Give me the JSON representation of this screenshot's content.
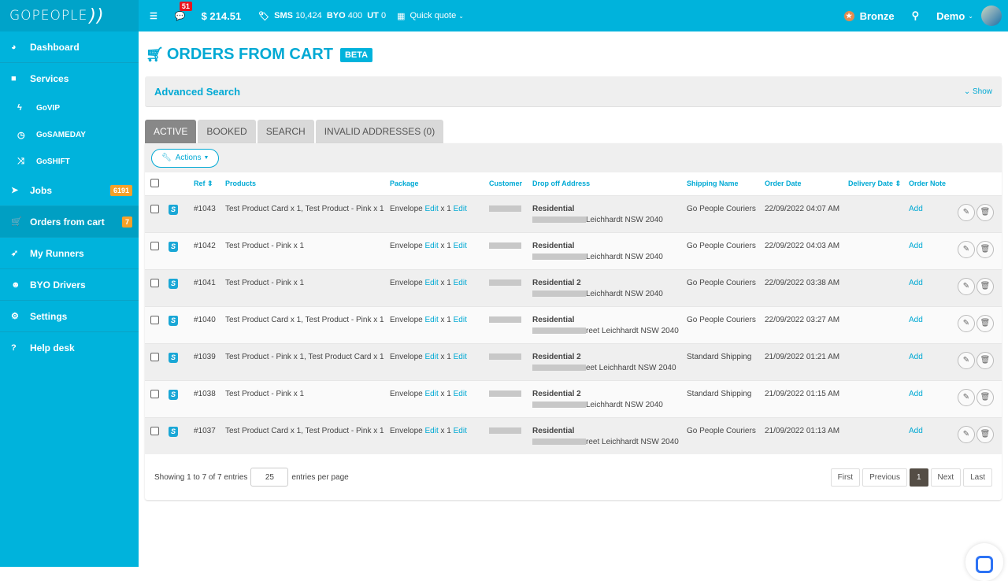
{
  "topbar": {
    "logo": "GOPEOPLE",
    "messages_badge": "51",
    "balance": "$ 214.51",
    "sms_label": "SMS",
    "sms_value": "10,424",
    "byo_label": "BYO",
    "byo_value": "400",
    "ut_label": "UT",
    "ut_value": "0",
    "quick_quote": "Quick quote",
    "tier": "Bronze",
    "user": "Demo"
  },
  "sidebar": {
    "items": [
      {
        "label": "Dashboard",
        "icon": "dashboard-icon"
      },
      {
        "label": "Services",
        "icon": "truck-icon"
      },
      {
        "label": "GoVIP",
        "icon": "bolt-icon"
      },
      {
        "label": "GoSAMEDAY",
        "icon": "clock-icon"
      },
      {
        "label": "GoSHIFT",
        "icon": "shuffle-icon"
      },
      {
        "label": "Jobs",
        "icon": "send-icon",
        "badge": "6191"
      },
      {
        "label": "Orders from cart",
        "icon": "cart-icon",
        "badge": "7"
      },
      {
        "label": "My Runners",
        "icon": "rocket-icon"
      },
      {
        "label": "BYO Drivers",
        "icon": "users-icon"
      },
      {
        "label": "Settings",
        "icon": "gear-icon"
      },
      {
        "label": "Help desk",
        "icon": "question-icon"
      }
    ]
  },
  "page": {
    "title": "ORDERS FROM CART",
    "badge": "BETA",
    "advanced_search": "Advanced Search",
    "show_label": "Show",
    "tabs": [
      "ACTIVE",
      "BOOKED",
      "SEARCH",
      "INVALID ADDRESSES (0)"
    ],
    "actions_label": "Actions"
  },
  "table": {
    "columns": [
      "Ref",
      "Products",
      "Package",
      "Customer",
      "Drop off Address",
      "Shipping Name",
      "Order Date",
      "Delivery Date",
      "Order Note"
    ],
    "package_prefix": "Envelope",
    "edit_label": "Edit",
    "qty_label": "x 1",
    "note_label": "Add",
    "rows": [
      {
        "ref": "#1043",
        "products": "Test Product Card x 1, Test Product - Pink x 1",
        "addr_type": "Residential",
        "addr": "Leichhardt NSW 2040",
        "shipping": "Go People Couriers",
        "order_date": "22/09/2022 04:07 AM"
      },
      {
        "ref": "#1042",
        "products": "Test Product - Pink x 1",
        "addr_type": "Residential",
        "addr": "Leichhardt NSW 2040",
        "shipping": "Go People Couriers",
        "order_date": "22/09/2022 04:03 AM"
      },
      {
        "ref": "#1041",
        "products": "Test Product - Pink x 1",
        "addr_type": "Residential 2",
        "addr": "Leichhardt NSW 2040",
        "shipping": "Go People Couriers",
        "order_date": "22/09/2022 03:38 AM"
      },
      {
        "ref": "#1040",
        "products": "Test Product Card x 1, Test Product - Pink x 1",
        "addr_type": "Residential",
        "addr": "reet Leichhardt NSW 2040",
        "shipping": "Go People Couriers",
        "order_date": "22/09/2022 03:27 AM"
      },
      {
        "ref": "#1039",
        "products": "Test Product - Pink x 1, Test Product Card x 1",
        "addr_type": "Residential 2",
        "addr": "eet Leichhardt NSW 2040",
        "shipping": "Standard Shipping",
        "order_date": "21/09/2022 01:21 AM"
      },
      {
        "ref": "#1038",
        "products": "Test Product - Pink x 1",
        "addr_type": "Residential 2",
        "addr": "Leichhardt NSW 2040",
        "shipping": "Standard Shipping",
        "order_date": "21/09/2022 01:15 AM"
      },
      {
        "ref": "#1037",
        "products": "Test Product Card x 1, Test Product - Pink x 1",
        "addr_type": "Residential",
        "addr": "reet Leichhardt NSW 2040",
        "shipping": "Go People Couriers",
        "order_date": "21/09/2022 01:13 AM"
      }
    ]
  },
  "footer": {
    "showing": "Showing 1 to 7 of 7 entries",
    "per_page_value": "25",
    "per_page_label": "entries per page",
    "pager": [
      "First",
      "Previous",
      "1",
      "Next",
      "Last"
    ]
  }
}
